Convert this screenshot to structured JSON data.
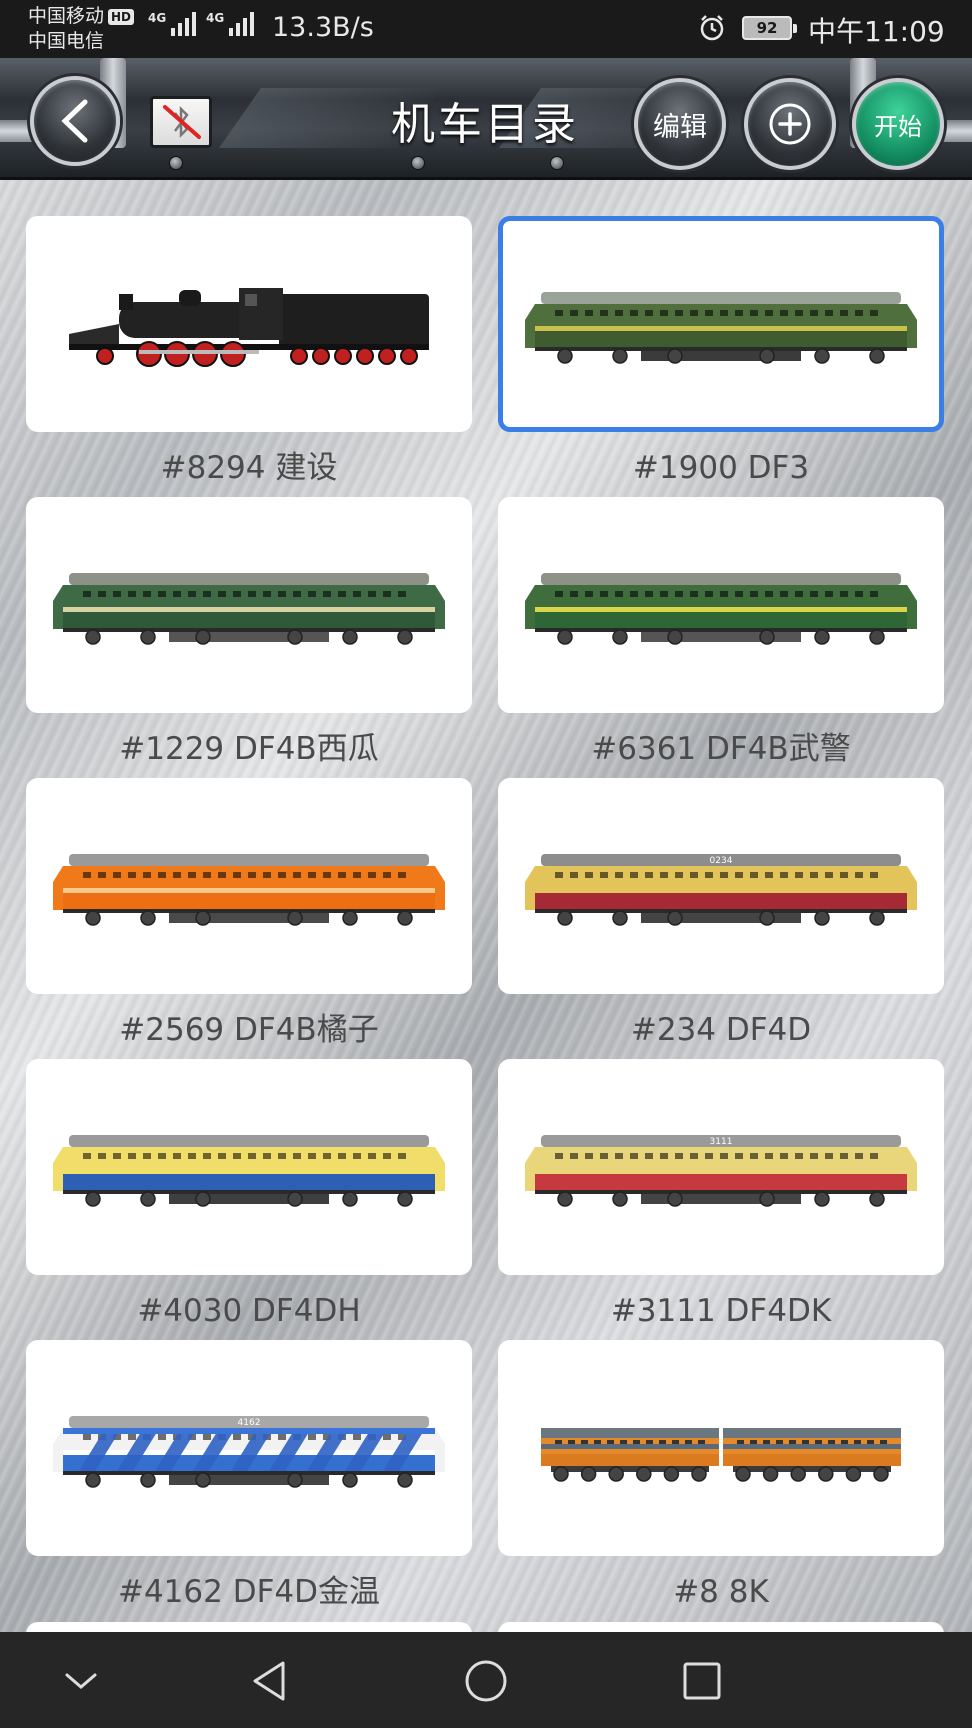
{
  "status_bar": {
    "carrier_1": "中国移动",
    "carrier_1_badge": "HD",
    "carrier_2": "中国电信",
    "network_1": "4G",
    "network_2": "4G",
    "speed": "13.3B/s",
    "battery": "92",
    "time": "中午11:09"
  },
  "header": {
    "title": "机车目录",
    "edit_label": "编辑",
    "start_label": "开始"
  },
  "locomotives": [
    {
      "label": "#8294 建设",
      "livery": "steam"
    },
    {
      "label": "#1900 DF3",
      "livery": "df3",
      "selected": true
    },
    {
      "label": "#1229 DF4B西瓜",
      "livery": "green"
    },
    {
      "label": "#6361 DF4B武警",
      "livery": "green-yellow"
    },
    {
      "label": "#2569 DF4B橘子",
      "livery": "orange"
    },
    {
      "label": "#234 DF4D",
      "livery": "red-yellow",
      "number": "0234"
    },
    {
      "label": "#4030 DF4DH",
      "livery": "blue-yellow"
    },
    {
      "label": "#3111 DF4DK",
      "livery": "yellow-red",
      "number": "3111"
    },
    {
      "label": "#4162 DF4D金温",
      "livery": "blue-white",
      "number": "4162"
    },
    {
      "label": "#8 8K",
      "livery": "twin-orange"
    }
  ],
  "colors": {
    "selected_border": "#3a7ee6",
    "start_button": "#149064",
    "caption_text": "#4a4a4a"
  }
}
